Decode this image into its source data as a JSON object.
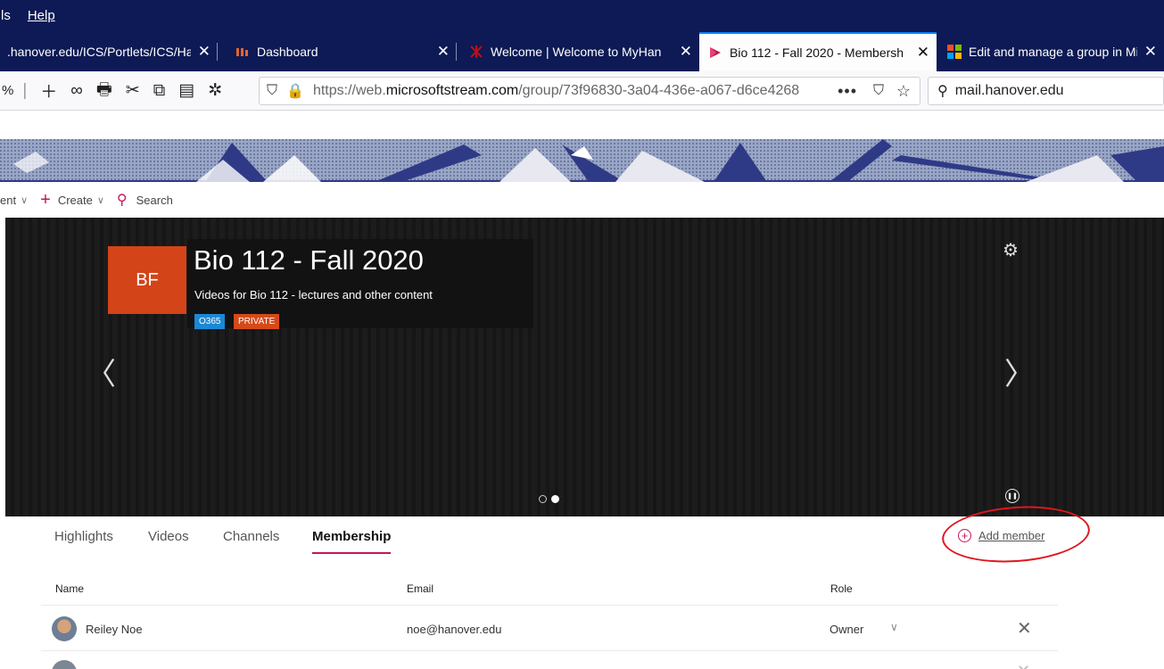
{
  "menubar": {
    "items": [
      "ls",
      "Help"
    ]
  },
  "tabs": [
    {
      "label": ".hanover.edu/ICS/Portlets/ICS/Ha",
      "favicon": "none"
    },
    {
      "label": "Dashboard",
      "favicon": "instructure-logo"
    },
    {
      "label": "Welcome | Welcome to MyHan",
      "favicon": "hanover-logo"
    },
    {
      "label": "Bio 112 - Fall 2020 - Membersh",
      "favicon": "stream-logo",
      "active": true
    },
    {
      "label": "Edit and manage a group in Mi",
      "favicon": "microsoft-logo"
    }
  ],
  "toolbar": {
    "zoom_fragment": "%",
    "url_prefix": "https://web.",
    "url_domain": "microsoftstream.com",
    "url_rest": "/group/73f96830-3a04-436e-a067-d6ce4268",
    "search_value": "mail.hanover.edu"
  },
  "streamnav": {
    "content_fragment": "ent",
    "create_label": "Create",
    "search_label": "Search"
  },
  "group": {
    "initials": "BF",
    "title": "Bio 112 - Fall 2020",
    "description": "Videos for Bio 112 - lectures and other content",
    "badges": [
      "O365",
      "PRIVATE"
    ]
  },
  "pivots": [
    "Highlights",
    "Videos",
    "Channels",
    "Membership"
  ],
  "add_member_label": "Add member",
  "table": {
    "headers": {
      "name": "Name",
      "email": "Email",
      "role": "Role"
    },
    "rows": [
      {
        "name": "Reiley Noe",
        "email": "noe@hanover.edu",
        "role": "Owner"
      }
    ]
  },
  "colors": {
    "accent": "#c2185b",
    "avatar_bg": "#d34418",
    "badge_o365": "#1b88d6",
    "badge_private": "#d44a1a",
    "annotation_circle": "#e0161e"
  }
}
